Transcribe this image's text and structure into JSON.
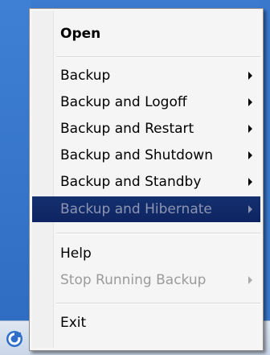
{
  "menu": {
    "items": [
      {
        "label": "Open",
        "bold": true,
        "submenu": false,
        "disabled": false,
        "selected": false
      },
      {
        "label": "Backup",
        "submenu": true
      },
      {
        "label": "Backup and Logoff",
        "submenu": true
      },
      {
        "label": "Backup and Restart",
        "submenu": true
      },
      {
        "label": "Backup and Shutdown",
        "submenu": true
      },
      {
        "label": "Backup and Standby",
        "submenu": true
      },
      {
        "label": "Backup and Hibernate",
        "submenu": true,
        "selected": true
      },
      {
        "label": "Help",
        "submenu": false
      },
      {
        "label": "Stop Running Backup",
        "submenu": true,
        "disabled": true
      },
      {
        "label": "Exit",
        "submenu": false
      }
    ]
  },
  "colors": {
    "highlight": "#0e2461",
    "highlight_text": "#8d95b3",
    "disabled_text": "#9b9b9b",
    "menu_bg": "#f5f5f5",
    "desktop": "#2a64b6",
    "taskbar": "#d4dfee"
  },
  "taskbar": {
    "tray_icons": [
      "backup-app-icon",
      "security-check-icon",
      "display-icon",
      "keyboard-icon",
      "network-error-icon",
      "monitor-icon"
    ]
  }
}
